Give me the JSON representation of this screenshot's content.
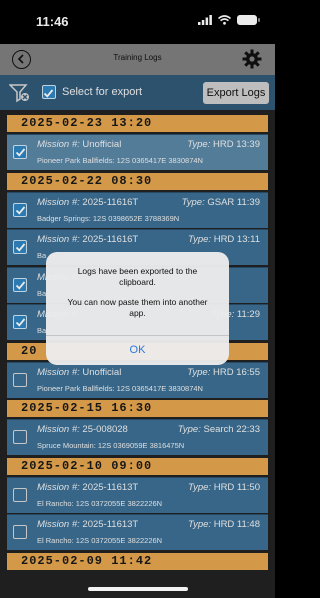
{
  "status": {
    "time": "11:46"
  },
  "nav": {
    "title": "Training Logs"
  },
  "toolbar": {
    "select_label": "Select for export",
    "export_label": "Export Logs"
  },
  "groups": [
    {
      "date": "2025-02-23 13:20",
      "rows": [
        {
          "mission": "Unofficial",
          "type": "HRD 13:39",
          "location": "Pioneer Park Ballfields: 12S 0365417E 3830874N",
          "checked": true
        }
      ]
    },
    {
      "date": "2025-02-22 08:30",
      "rows": [
        {
          "mission": "2025-11616T",
          "type": "GSAR 11:39",
          "location": "Badger Springs: 12S 0398652E 3788369N",
          "checked": true
        },
        {
          "mission": "2025-11616T",
          "type": "HRD 13:11",
          "location": "Ba",
          "checked": true
        },
        {
          "mission": "",
          "type": "",
          "location": "Ba",
          "checked": true
        },
        {
          "mission": "",
          "type": "11:29",
          "location": "Ba",
          "checked": true
        }
      ]
    },
    {
      "date": "20",
      "rows": [
        {
          "mission": "Unofficial",
          "type": "HRD 16:55",
          "location": "Pioneer Park Ballfields: 12S 0365417E 3830874N",
          "checked": false
        }
      ]
    },
    {
      "date": "2025-02-15 16:30",
      "rows": [
        {
          "mission": "25-008028",
          "type": "Search 22:33",
          "location": "Spruce Mountain: 12S 0369059E 3816475N",
          "checked": false
        }
      ]
    },
    {
      "date": "2025-02-10 09:00",
      "rows": [
        {
          "mission": "2025-11613T",
          "type": "HRD 11:50",
          "location": "El Rancho: 12S 0372055E 3822226N",
          "checked": false
        },
        {
          "mission": "2025-11613T",
          "type": "HRD 11:48",
          "location": "El Rancho: 12S 0372055E 3822226N",
          "checked": false
        }
      ]
    },
    {
      "date": "2025-02-09 11:42",
      "rows": []
    }
  ],
  "labels": {
    "mission_prefix": "Mission #:",
    "type_prefix": "Type:"
  },
  "alert": {
    "message1": "Logs have been exported to the clipboard.",
    "message2": "You can now paste them into another app.",
    "ok_label": "OK"
  }
}
